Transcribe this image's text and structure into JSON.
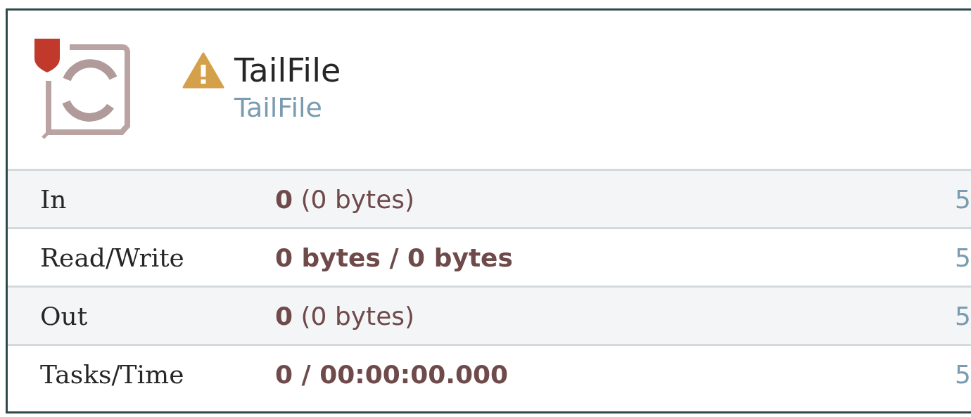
{
  "processor": {
    "name": "TailFile",
    "type": "TailFile",
    "warning": true,
    "restricted": true
  },
  "stats": [
    {
      "label": "In",
      "value": "**0** (0 bytes)",
      "column_3": "5"
    },
    {
      "label": "Read/Write",
      "value": "0 bytes / 0 bytes",
      "column_3": "5"
    },
    {
      "label": "Out",
      "value": "**0** (0 bytes)",
      "column_3": "5"
    },
    {
      "label": "Tasks/Time",
      "value": "0 / 00:00:00.000",
      "column_3": "5"
    }
  ]
}
